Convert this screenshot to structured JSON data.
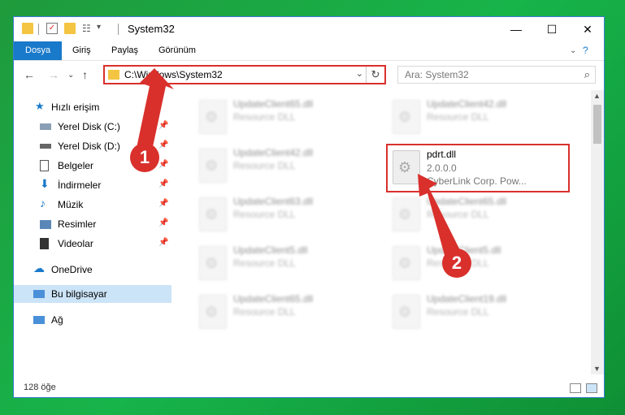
{
  "window": {
    "title": "System32"
  },
  "ribbon": {
    "tabs": [
      "Dosya",
      "Giriş",
      "Paylaş",
      "Görünüm"
    ]
  },
  "address": {
    "path": "C:\\Windows\\System32"
  },
  "search": {
    "placeholder": "Ara: System32"
  },
  "sidebar": {
    "quick_access": "Hızlı erişim",
    "items": [
      {
        "label": "Yerel Disk (C:)"
      },
      {
        "label": "Yerel Disk (D:)"
      },
      {
        "label": "Belgeler"
      },
      {
        "label": "İndirmeler"
      },
      {
        "label": "Müzik"
      },
      {
        "label": "Resimler"
      },
      {
        "label": "Videolar"
      }
    ],
    "onedrive": "OneDrive",
    "this_pc": "Bu bilgisayar",
    "network": "Ağ"
  },
  "files": {
    "left": [
      {
        "name": "UpdateClient65.dll",
        "desc": "Resource DLL"
      },
      {
        "name": "UpdateClient42.dll",
        "desc": "Resource DLL"
      },
      {
        "name": "UpdateClient63.dll",
        "desc": "Resource DLL"
      },
      {
        "name": "UpdateClient5.dll",
        "desc": "Resource DLL"
      },
      {
        "name": "UpdateClient65.dll",
        "desc": "Resource DLL"
      }
    ],
    "right": [
      {
        "name": "UpdateClient42.dll",
        "desc": "Resource DLL"
      },
      {
        "name": "UpdateClient65.dll",
        "desc": "Resource DLL"
      },
      {
        "name": "UpdateClient5.dll",
        "desc": "Resource DLL"
      },
      {
        "name": "UpdateClient19.dll",
        "desc": "Resource DLL"
      }
    ],
    "selected": {
      "name": "pdrt.dll",
      "version": "2.0.0.0",
      "company": "CyberLink Corp. Pow..."
    }
  },
  "status": {
    "count": "128 öğe"
  },
  "annotations": {
    "step1": "1",
    "step2": "2",
    "color": "#d9302c"
  }
}
